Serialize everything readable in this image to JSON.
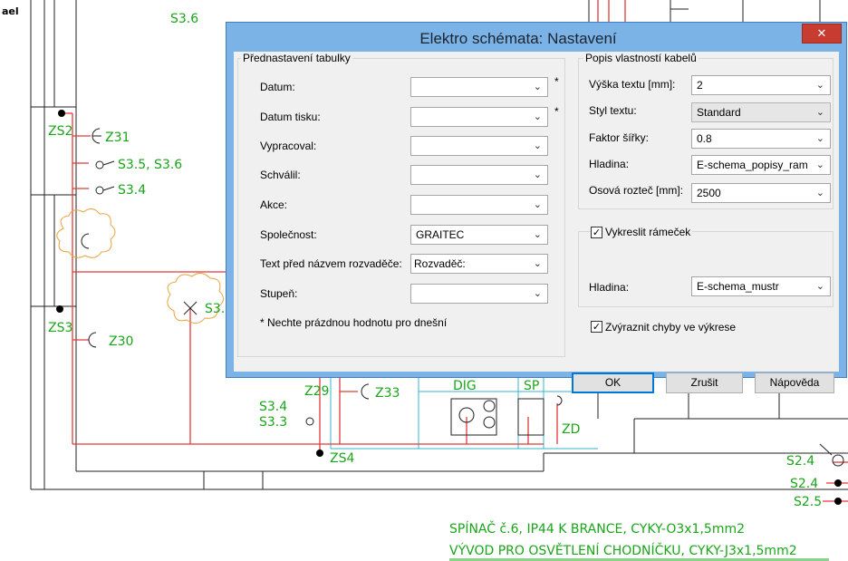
{
  "dialog": {
    "title": "Elektro schémata: Nastavení",
    "close_label": "✕",
    "table_group": {
      "title": "Přednastavení tabulky",
      "fields": [
        {
          "label": "Datum:",
          "value": "",
          "required_mark": "*"
        },
        {
          "label": "Datum tisku:",
          "value": "",
          "required_mark": "*"
        },
        {
          "label": "Vypracoval:",
          "value": ""
        },
        {
          "label": "Schválil:",
          "value": ""
        },
        {
          "label": "Akce:",
          "value": ""
        },
        {
          "label": "Společnost:",
          "value": "GRAITEC"
        },
        {
          "label": "Text před názvem rozvaděče:",
          "value": "Rozvaděč:"
        },
        {
          "label": "Stupeň:",
          "value": ""
        }
      ],
      "note": "* Nechte prázdnou hodnotu pro dnešní"
    },
    "cable_group": {
      "title": "Popis vlastností kabelů",
      "fields": [
        {
          "label": "Výška textu [mm]:",
          "value": "2"
        },
        {
          "label": "Styl textu:",
          "value": "Standard"
        },
        {
          "label": "Faktor šířky:",
          "value": "0.8"
        },
        {
          "label": "Hladina:",
          "value": "E-schema_popisy_ram"
        },
        {
          "label": "Osová rozteč [mm]:",
          "value": "2500"
        }
      ]
    },
    "frame_group": {
      "checkbox_label": "Vykreslit rámeček",
      "checked": true,
      "layer_label": "Hladina:",
      "layer_value": "E-schema_mustr"
    },
    "highlight_errors": {
      "label": "Zvýraznit chyby ve výkrese",
      "checked": true
    },
    "buttons": {
      "ok": "OK",
      "cancel": "Zrušit",
      "help": "Nápověda"
    },
    "dropdown_arrow": "⌄"
  },
  "drawing": {
    "labels": {
      "s36_top": "S3.6",
      "zs2": "ZS2",
      "z31": "Z31",
      "s35_s36": "S3.5, S3.6",
      "s34_left": "S3.4",
      "s3_partial": "S3.",
      "zs3": "ZS3",
      "z30": "Z30",
      "z29": "Z29",
      "z33": "Z33",
      "dig": "DIG",
      "sp": "SP",
      "s34_bottom": "S3.4",
      "s33": "S3.3",
      "zd": "ZD",
      "zs4": "ZS4",
      "s24_a": "S2.4",
      "s24_b": "S2.4",
      "s25": "S2.5",
      "cable_note_1": "SPÍNAČ č.6, IP44 K BRANCE, CYKY-O3x1,5mm2",
      "cable_note_2": "VÝVOD PRO OSVĚTLENÍ CHODNÍČKU, CYKY-J3x1,5mm2",
      "corner": "ael"
    },
    "colors": {
      "wire": "#e03a3a",
      "text": "#1aa51a",
      "cloud": "#e8a33a",
      "cyan": "#33b5cc",
      "lines": "#222222"
    }
  }
}
